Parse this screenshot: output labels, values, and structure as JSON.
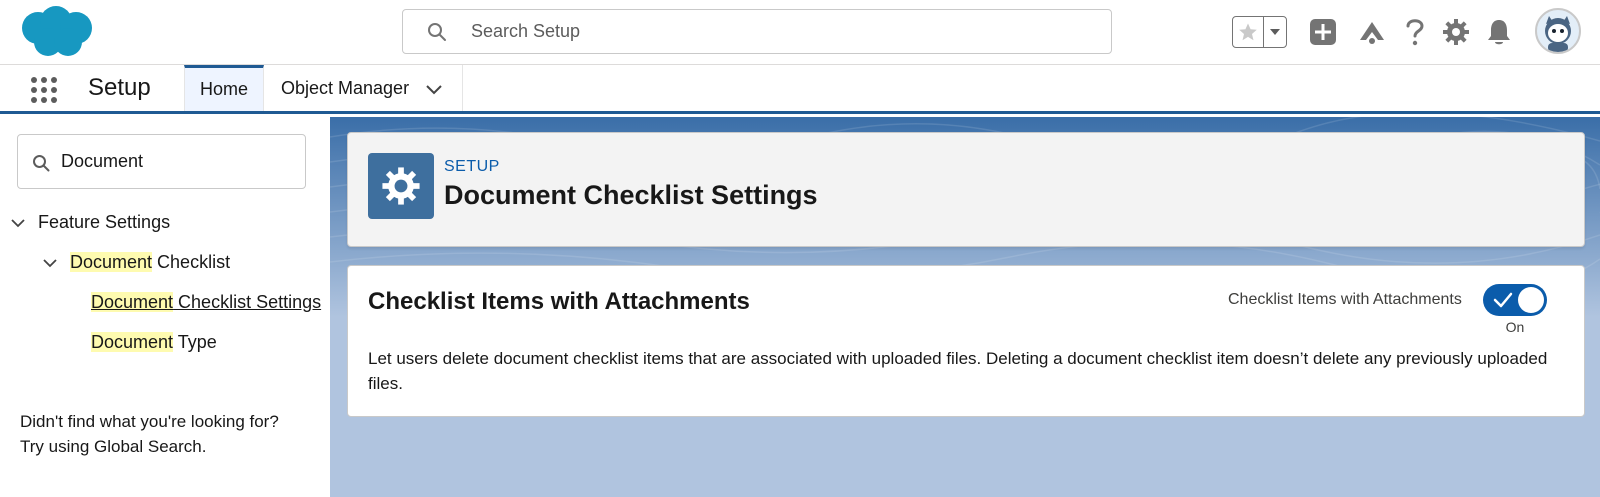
{
  "header": {
    "logo": "salesforce-cloud-logo",
    "search_placeholder": "Search Setup",
    "icons": [
      "star-icon",
      "chevron-down-icon",
      "plus-icon",
      "trailhead-icon",
      "help-icon",
      "gear-icon",
      "bell-icon",
      "avatar"
    ]
  },
  "nav": {
    "app_name": "Setup",
    "tabs": [
      {
        "label": "Home",
        "active": true
      },
      {
        "label": "Object Manager",
        "has_dropdown": true
      }
    ]
  },
  "sidebar": {
    "quick_find_value": "Document",
    "tree": {
      "feature_settings": "Feature Settings",
      "document_checklist": {
        "hl": "Document",
        "rest": " Checklist"
      },
      "document_checklist_settings": {
        "hl": "Document",
        "rest": " Checklist Settings"
      },
      "document_type": {
        "hl": "Document",
        "rest": " Type"
      }
    },
    "not_found_line1": "Didn't find what you're looking for?",
    "not_found_line2": "Try using Global Search."
  },
  "page_header": {
    "eyebrow": "SETUP",
    "title": "Document Checklist Settings",
    "icon": "gear-icon"
  },
  "card": {
    "title": "Checklist Items with Attachments",
    "toggle_label": "Checklist Items with Attachments",
    "toggle_on": true,
    "toggle_state": "On",
    "description": "Let users delete document checklist items that are associated with uploaded files. Deleting a document checklist item doesn’t delete any previously uploaded files."
  },
  "colors": {
    "brand_blue": "#0b5cab",
    "nav_accent": "#1f5a93",
    "highlight": "#fefbb0",
    "main_bg": "#b0c4df",
    "header_icon_bg": "#3e6f9e"
  }
}
